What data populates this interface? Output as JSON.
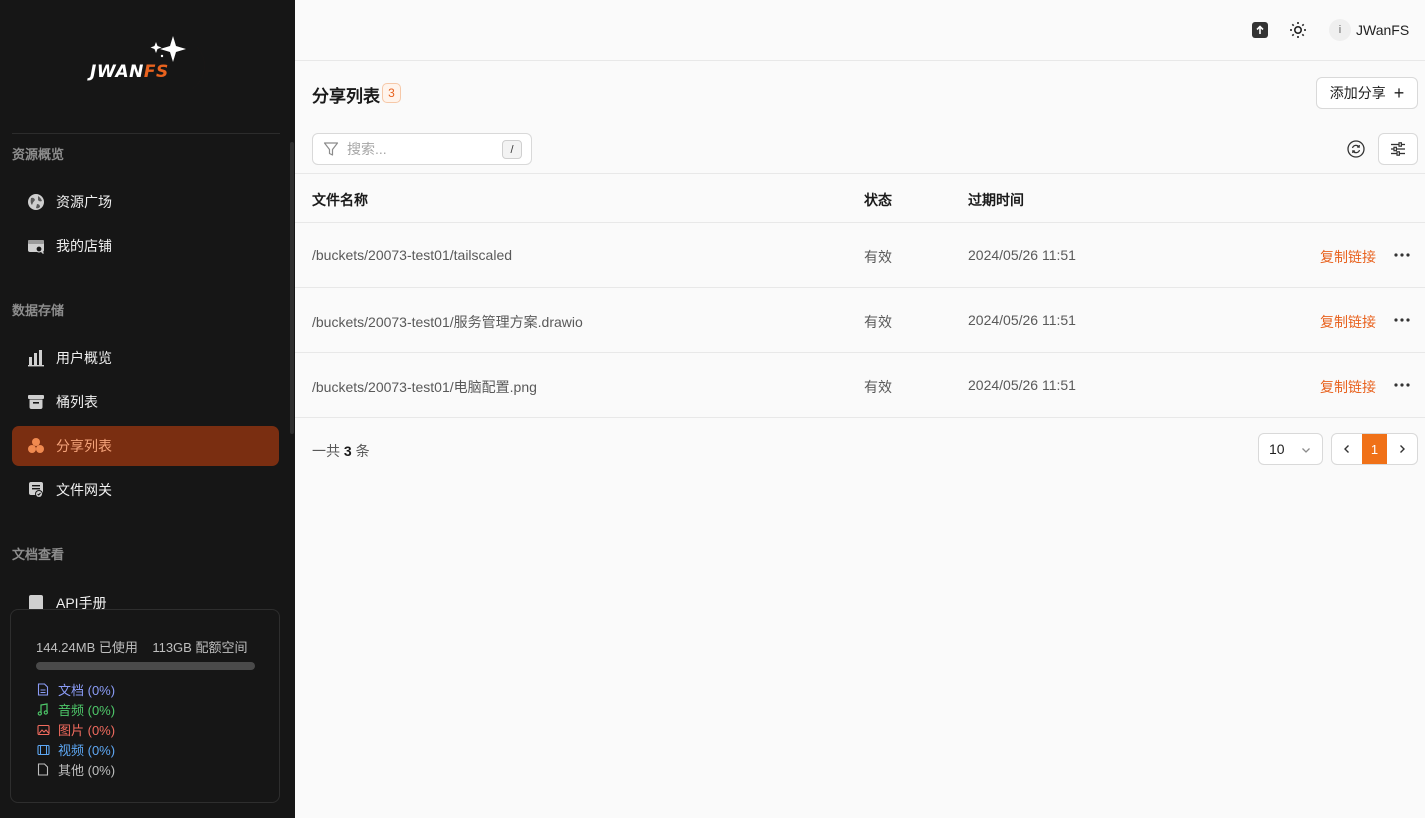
{
  "app": {
    "logo_text_main": "JWAN",
    "logo_text_fs": "FS",
    "brand_color": "#e8621e"
  },
  "sidebar": {
    "sections": [
      {
        "title": "资源概览",
        "items": [
          {
            "label": "资源广场",
            "icon": "globe-icon"
          },
          {
            "label": "我的店铺",
            "icon": "store-icon"
          }
        ]
      },
      {
        "title": "数据存储",
        "items": [
          {
            "label": "用户概览",
            "icon": "bar-chart-icon"
          },
          {
            "label": "桶列表",
            "icon": "bucket-icon"
          },
          {
            "label": "分享列表",
            "icon": "share-cluster-icon",
            "active": true
          },
          {
            "label": "文件网关",
            "icon": "gateway-icon"
          }
        ]
      },
      {
        "title": "文档查看",
        "items": [
          {
            "label": "API手册",
            "icon": "api-book-icon"
          }
        ]
      }
    ],
    "storage": {
      "used": "144.24MB 已使用",
      "quota": "113GB 配额空间",
      "usage_fraction": 0.0,
      "legend": [
        {
          "label": "文档 (0%)",
          "color": "#8b9cf7",
          "icon": "document-icon"
        },
        {
          "label": "音频 (0%)",
          "color": "#4ec96a",
          "icon": "music-icon"
        },
        {
          "label": "图片 (0%)",
          "color": "#f26b5e",
          "icon": "image-icon"
        },
        {
          "label": "视频 (0%)",
          "color": "#5da8f5",
          "icon": "film-icon"
        },
        {
          "label": "其他 (0%)",
          "color": "#bfbfbf",
          "icon": "file-icon"
        }
      ]
    }
  },
  "topbar": {
    "upload_icon": "upload-icon",
    "theme_icon": "sun-icon",
    "avatar_initial": "i",
    "username": "JWanFS"
  },
  "page": {
    "title": "分享列表",
    "count": "3",
    "add_button": "添加分享",
    "search_placeholder": "搜索...",
    "search_shortcut": "/"
  },
  "table": {
    "columns": [
      "文件名称",
      "状态",
      "过期时间"
    ],
    "rows": [
      {
        "name": "/buckets/20073-test01/tailscaled",
        "status": "有效",
        "expire": "2024/05/26 11:51",
        "action": "复制链接"
      },
      {
        "name": "/buckets/20073-test01/服务管理方案.drawio",
        "status": "有效",
        "expire": "2024/05/26 11:51",
        "action": "复制链接"
      },
      {
        "name": "/buckets/20073-test01/电脑配置.png",
        "status": "有效",
        "expire": "2024/05/26 11:51",
        "action": "复制链接"
      }
    ]
  },
  "pagination": {
    "total_prefix": "一共",
    "total": "3",
    "total_suffix": "条",
    "page_size": "10",
    "current_page": "1"
  }
}
